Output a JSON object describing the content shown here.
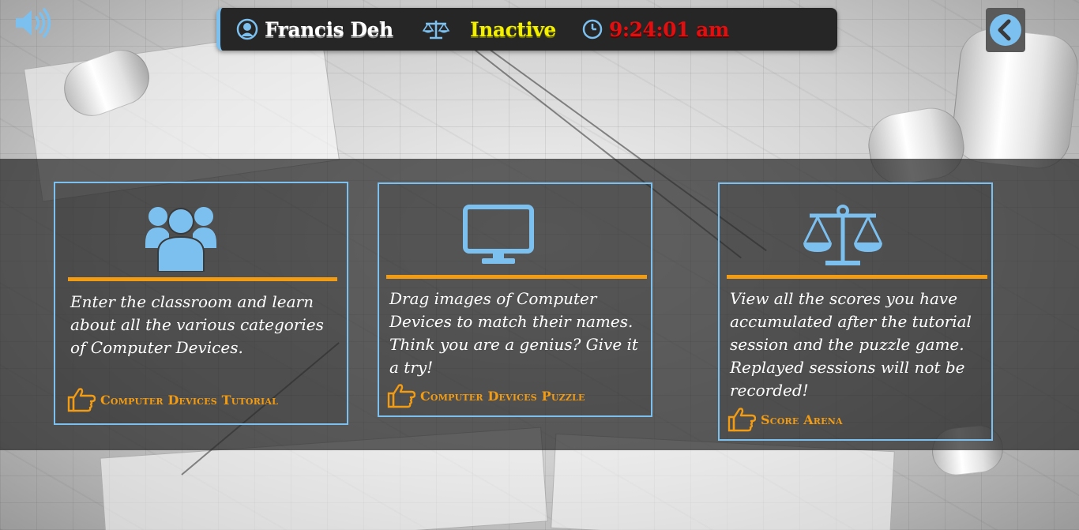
{
  "header": {
    "user_name": "Francis Deh",
    "status": "Inactive",
    "time": "9:24:01 am"
  },
  "icons": {
    "sound": "speaker-volume-icon",
    "user": "user-circle-icon",
    "status": "balance-scale-icon",
    "clock": "clock-icon",
    "back": "chevron-left-circle-icon",
    "pointer": "hand-pointing-icon"
  },
  "colors": {
    "accent": "#7cc0f0",
    "link": "#f39c12",
    "status_text": "#f2ef00",
    "time_text": "#e01010"
  },
  "cards": [
    {
      "icon": "group-users-icon",
      "description": "Enter the classroom and learn about all the various categories of Computer Devices.",
      "link_label": "Computer Devices Tutorial"
    },
    {
      "icon": "desktop-monitor-icon",
      "description": "Drag images of Computer Devices to match their names. Think you are a genius? Give it a try!",
      "link_label": "Computer Devices Puzzle"
    },
    {
      "icon": "balance-scale-icon",
      "description": "View all the scores you have accumulated after the tutorial session and the puzzle game. Replayed sessions will not be recorded!",
      "link_label": "Score Arena"
    }
  ]
}
